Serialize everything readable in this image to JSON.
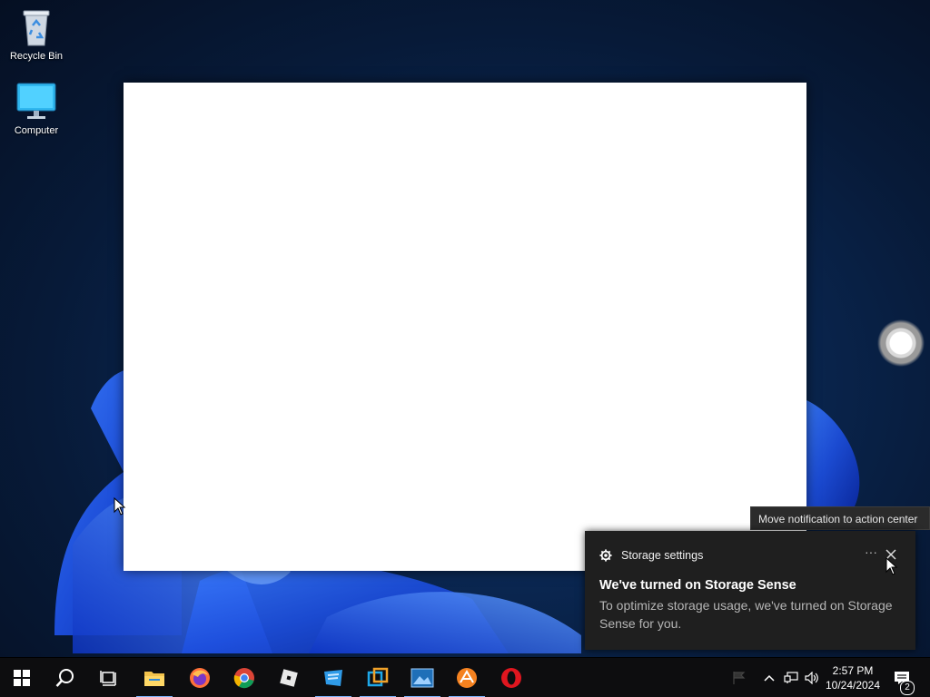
{
  "desktop": {
    "icons": [
      {
        "label": "Recycle Bin",
        "icon": "recycle-bin-icon"
      },
      {
        "label": "Computer",
        "icon": "computer-icon"
      }
    ]
  },
  "tooltip": {
    "text": "Move notification to action center"
  },
  "toast": {
    "app_name": "Storage settings",
    "app_icon": "gear-icon",
    "more_label": "···",
    "title": "We've turned on Storage Sense",
    "body": "To optimize storage usage, we've turned on Storage Sense for you."
  },
  "taskbar": {
    "items": [
      {
        "name": "start",
        "icon": "windows-logo-icon",
        "running": false
      },
      {
        "name": "search",
        "icon": "search-icon",
        "running": false
      },
      {
        "name": "task-view",
        "icon": "task-view-icon",
        "running": false
      },
      {
        "name": "file-explorer",
        "icon": "folder-icon",
        "running": true
      },
      {
        "name": "firefox",
        "icon": "firefox-icon",
        "running": false
      },
      {
        "name": "chrome",
        "icon": "chrome-icon",
        "running": false
      },
      {
        "name": "roblox",
        "icon": "roblox-icon",
        "running": false
      },
      {
        "name": "app-blue",
        "icon": "blue-app-icon",
        "running": true
      },
      {
        "name": "app-teal",
        "icon": "teal-app-icon",
        "running": true
      },
      {
        "name": "app-photo",
        "icon": "photo-app-icon",
        "running": true
      },
      {
        "name": "app-orange",
        "icon": "orange-app-icon",
        "running": true
      },
      {
        "name": "opera",
        "icon": "opera-icon",
        "running": false
      }
    ],
    "tray": {
      "chevron": "chevron-up-icon",
      "network": "network-icon",
      "volume": "volume-icon",
      "time": "2:57 PM",
      "date": "10/24/2024",
      "notifications_count": "2"
    }
  },
  "colors": {
    "taskbar_bg": "#0d0d0f",
    "toast_bg": "#1f1f1f",
    "accent": "#7fb6ff"
  }
}
